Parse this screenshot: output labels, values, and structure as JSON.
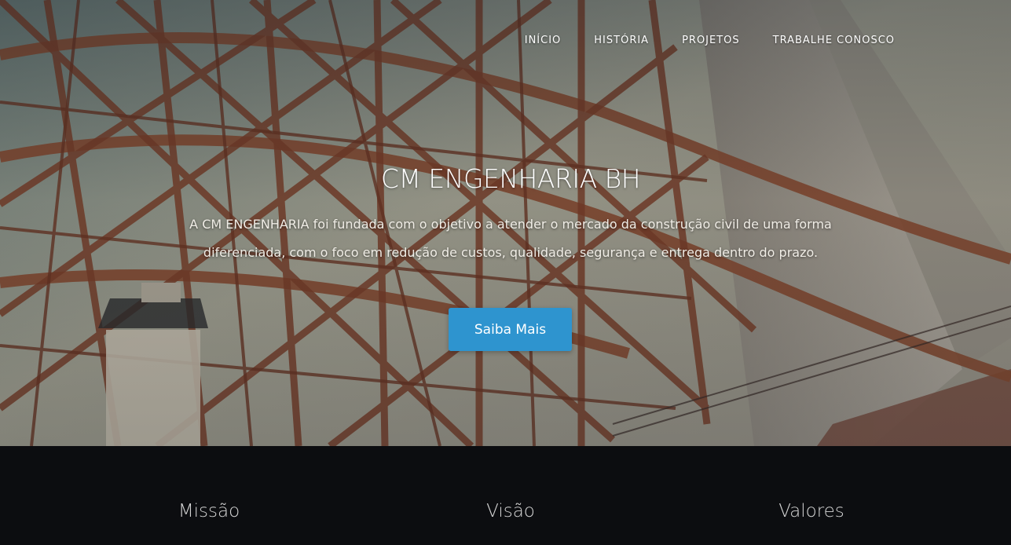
{
  "nav": {
    "items": [
      {
        "label": "INÍCIO"
      },
      {
        "label": "HISTÓRIA"
      },
      {
        "label": "PROJETOS"
      },
      {
        "label": "TRABALHE CONOSCO"
      }
    ]
  },
  "hero": {
    "title": "CM ENGENHARIA BH",
    "description": "A CM ENGENHARIA foi fundada com o objetivo a atender o mercado da construção civil de uma forma diferenciada, com o foco em redução de custos, qualidade, segurança e entrega dentro do prazo.",
    "cta_label": "Saiba Mais",
    "background_image": "steel-bridge-structure-photo"
  },
  "sections": {
    "mission": "Missão",
    "vision": "Visão",
    "values": "Valores"
  },
  "colors": {
    "accent": "#2e94cf",
    "dark_section": "#0c0d10",
    "steel": "#8a4a2e"
  }
}
